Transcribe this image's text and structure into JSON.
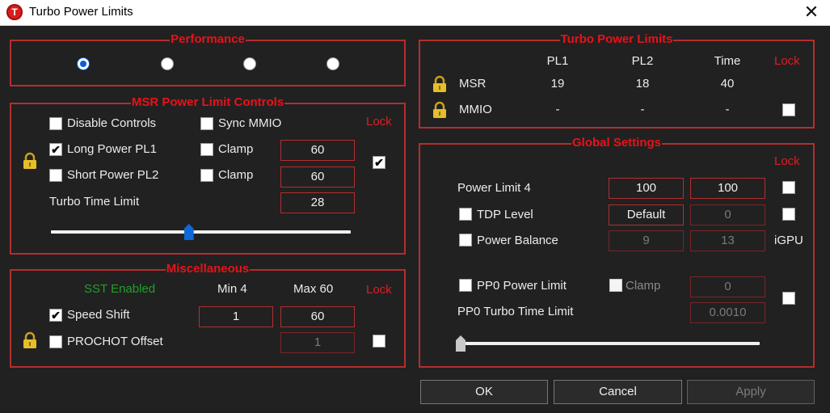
{
  "window": {
    "title": "Turbo Power Limits",
    "app_icon_letter": "T",
    "close_glyph": "✕"
  },
  "performance": {
    "title": "Performance",
    "options": [
      {
        "selected": true
      },
      {
        "selected": false
      },
      {
        "selected": false
      },
      {
        "selected": false
      }
    ]
  },
  "msr_controls": {
    "title": "MSR Power Limit Controls",
    "lock_label": "Lock",
    "disable_controls": {
      "label": "Disable Controls",
      "checked": false
    },
    "sync_mmio": {
      "label": "Sync MMIO",
      "checked": false
    },
    "long_power": {
      "label": "Long Power PL1",
      "checked": true,
      "clamp_label": "Clamp",
      "clamp_checked": false,
      "value": "60"
    },
    "short_power": {
      "label": "Short Power PL2",
      "checked": false,
      "clamp_label": "Clamp",
      "clamp_checked": false,
      "value": "60"
    },
    "turbo_time": {
      "label": "Turbo Time Limit",
      "value": "28"
    },
    "lock_checked": true,
    "slider_fraction": 0.46
  },
  "misc": {
    "title": "Miscellaneous",
    "sst_status": "SST Enabled",
    "min_label": "Min  4",
    "max_label": "Max  60",
    "lock_label": "Lock",
    "speed_shift": {
      "label": "Speed Shift",
      "checked": true,
      "min_value": "1",
      "max_value": "60"
    },
    "prochot": {
      "label": "PROCHOT Offset",
      "checked": false,
      "value": "1"
    },
    "lock_checked": false
  },
  "turbo_limits": {
    "title": "Turbo Power Limits",
    "headers": {
      "pl1": "PL1",
      "pl2": "PL2",
      "time": "Time",
      "lock": "Lock"
    },
    "rows": [
      {
        "name": "MSR",
        "pl1": "19",
        "pl2": "18",
        "time": "40"
      },
      {
        "name": "MMIO",
        "pl1": "-",
        "pl2": "-",
        "time": "-",
        "lock_checked": false
      }
    ]
  },
  "global": {
    "title": "Global Settings",
    "lock_label": "Lock",
    "power_limit_4": {
      "label": "Power Limit 4",
      "value1": "100",
      "value2": "100",
      "lock_checked": false
    },
    "tdp_level": {
      "label": "TDP Level",
      "checked": false,
      "value1": "Default",
      "value2": "0",
      "lock_checked": false
    },
    "power_balance": {
      "label": "Power Balance",
      "checked": false,
      "value1": "9",
      "value2": "13",
      "igpu_label": "iGPU"
    },
    "pp0_power_limit": {
      "label": "PP0 Power Limit",
      "checked": false,
      "clamp_label": "Clamp",
      "clamp_checked": false,
      "value": "0",
      "lock_checked": false
    },
    "pp0_turbo_time": {
      "label": "PP0 Turbo Time Limit",
      "value": "0.0010"
    },
    "slider_fraction": 0.0
  },
  "buttons": {
    "ok": "OK",
    "cancel": "Cancel",
    "apply": "Apply"
  },
  "colors": {
    "accent_red": "#e11b22",
    "frame_red": "#b32e2e",
    "sst_green": "#1fa02a",
    "radio_blue": "#0a5dd6",
    "background": "#212121"
  },
  "icons": {
    "lock": "padlock-icon",
    "close": "close-icon",
    "app": "app-logo-icon"
  }
}
